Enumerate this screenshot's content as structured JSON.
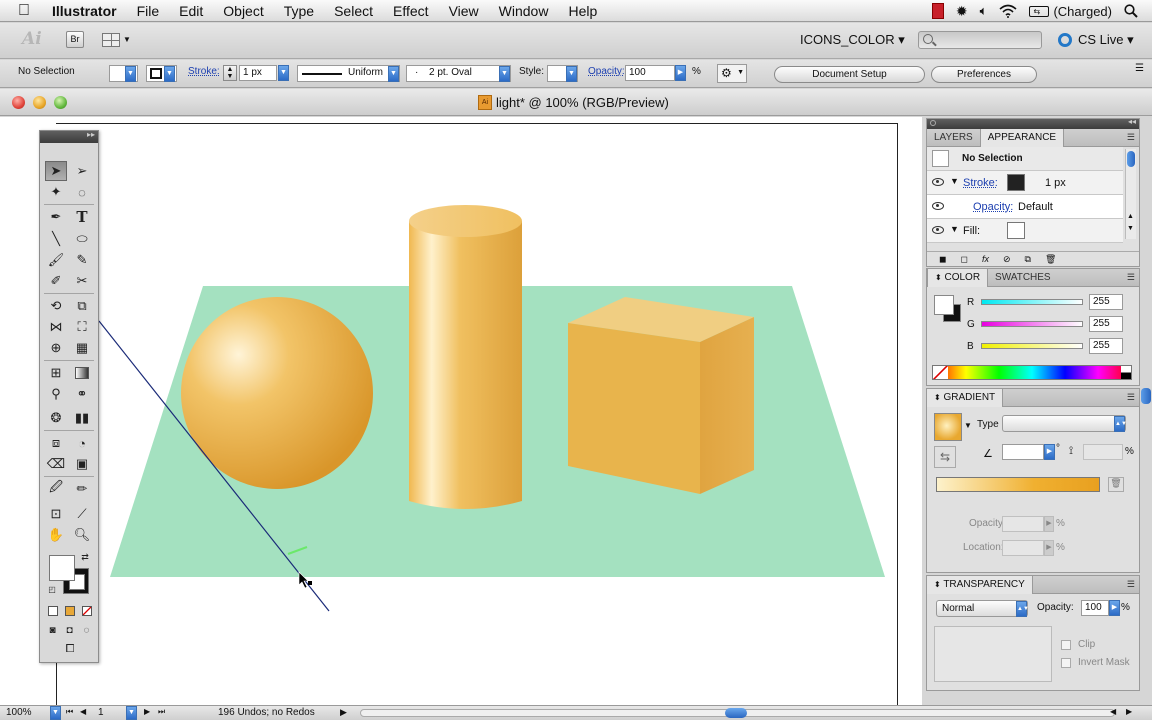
{
  "menubar": {
    "app_name": "Illustrator",
    "items": [
      "File",
      "Edit",
      "Object",
      "Type",
      "Select",
      "Effect",
      "View",
      "Window",
      "Help"
    ],
    "battery_status": "(Charged)"
  },
  "appbar": {
    "bridge_label": "Br",
    "workspace": "ICONS_COLOR ▾",
    "cs_live": "CS Live ▾"
  },
  "control": {
    "selection_label": "No Selection",
    "stroke_label": "Stroke:",
    "stroke_weight": "1 px",
    "profile_label": "Uniform",
    "brush_dot": "·",
    "brush_label": "2 pt. Oval",
    "style_label": "Style:",
    "opacity_label": "Opacity:",
    "opacity_value": "100",
    "opacity_unit": "%",
    "doc_setup_button": "Document Setup",
    "preferences_button": "Preferences"
  },
  "document": {
    "title": "light* @ 100% (RGB/Preview)",
    "file_badge": "Ai"
  },
  "layers_panel": {
    "tabs": [
      "LAYERS",
      "APPEARANCE"
    ],
    "rows": {
      "selection": "No Selection",
      "stroke_label": "Stroke:",
      "stroke_value": "1 px",
      "opacity_label": "Opacity:",
      "opacity_value": "Default",
      "fill_label": "Fill:"
    }
  },
  "color_panel": {
    "tabs": [
      "COLOR",
      "SWATCHES"
    ],
    "channels": [
      {
        "label": "R",
        "value": "255",
        "color": "#22d0f0"
      },
      {
        "label": "G",
        "value": "255",
        "color": "#e020d0"
      },
      {
        "label": "B",
        "value": "255",
        "color": "#f0f020"
      }
    ]
  },
  "gradient_panel": {
    "title": "GRADIENT",
    "type_label": "Type",
    "degree_unit": "°",
    "percent_unit": "%",
    "opacity_label": "Opacity:",
    "location_label": "Location:",
    "gradient_colors": [
      "#fdf2cc",
      "#f0b030",
      "#e8a020"
    ]
  },
  "transparency_panel": {
    "title": "TRANSPARENCY",
    "blend_mode": "Normal",
    "opacity_label": "Opacity:",
    "opacity_value": "100",
    "opacity_unit": "%",
    "clip_label": "Clip",
    "invert_mask_label": "Invert Mask"
  },
  "statusbar": {
    "zoom": "100%",
    "artboard_number": "1",
    "status_text": "196 Undos; no Redos"
  },
  "colors": {
    "ground": "#a4e1c0",
    "gold": "#e8b44c",
    "path_line": "#1a2a78"
  }
}
